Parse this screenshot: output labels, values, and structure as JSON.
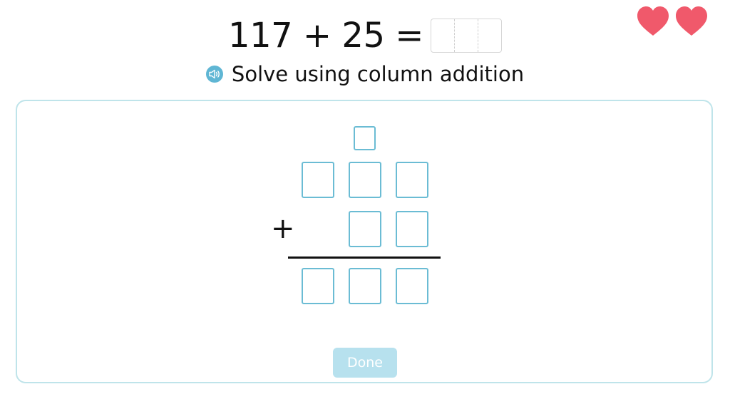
{
  "question": {
    "expression": "117 + 25 =",
    "instruction": "Solve using column addition"
  },
  "lives": {
    "count": 2,
    "color": "#f0596b"
  },
  "icons": {
    "speaker": "speaker-icon",
    "heart": "heart-icon"
  },
  "colors": {
    "box_border": "#6bbcd4",
    "panel_border": "#bfe4ea",
    "button_bg": "#b7e1ee"
  },
  "column_addition": {
    "operator": "+",
    "carry_cells": 1,
    "first_addend_cells": 3,
    "second_addend_cells": 2,
    "result_cells": 3
  },
  "done_button": {
    "label": "Done"
  }
}
